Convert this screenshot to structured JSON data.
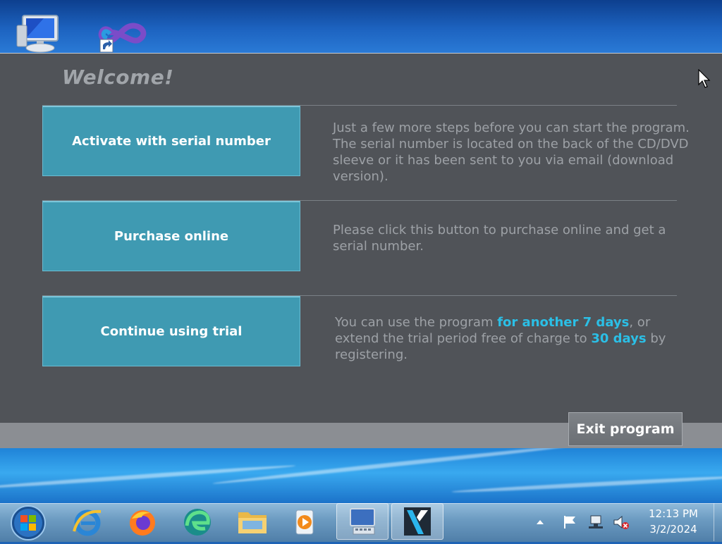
{
  "dialog": {
    "heading": "Welcome!",
    "options": [
      {
        "label": "Activate with serial number",
        "description": "Just a few more steps before you can start the program. The serial number is located on the back of the CD/DVD sleeve or it has been sent to you via email (download version)."
      },
      {
        "label": "Purchase online",
        "description": "Please click this button to purchase online and get a serial number."
      },
      {
        "label": "Continue using trial",
        "description_parts": {
          "p1": "You can use the program ",
          "h1": "for another 7 days",
          "p2": ", or extend the trial period free of charge to ",
          "h2": "30 days",
          "p3": " by registering."
        }
      }
    ],
    "exit_label": "Exit program",
    "colors": {
      "background": "#505358",
      "button": "#3f9ab2",
      "highlight": "#2bbfe6"
    }
  },
  "desktop": {
    "icons": [
      "computer-icon",
      "infinity-shortcut-icon"
    ]
  },
  "taskbar": {
    "pinned": [
      "internet-explorer-icon",
      "firefox-icon",
      "edge-icon",
      "file-explorer-icon",
      "media-player-icon",
      "on-screen-keyboard-icon",
      "video-editor-icon"
    ],
    "tray": [
      "show-hidden-icons-icon",
      "action-center-flag-icon",
      "network-icon",
      "volume-muted-icon"
    ],
    "clock": {
      "time": "12:13 PM",
      "date": "3/2/2024"
    }
  }
}
